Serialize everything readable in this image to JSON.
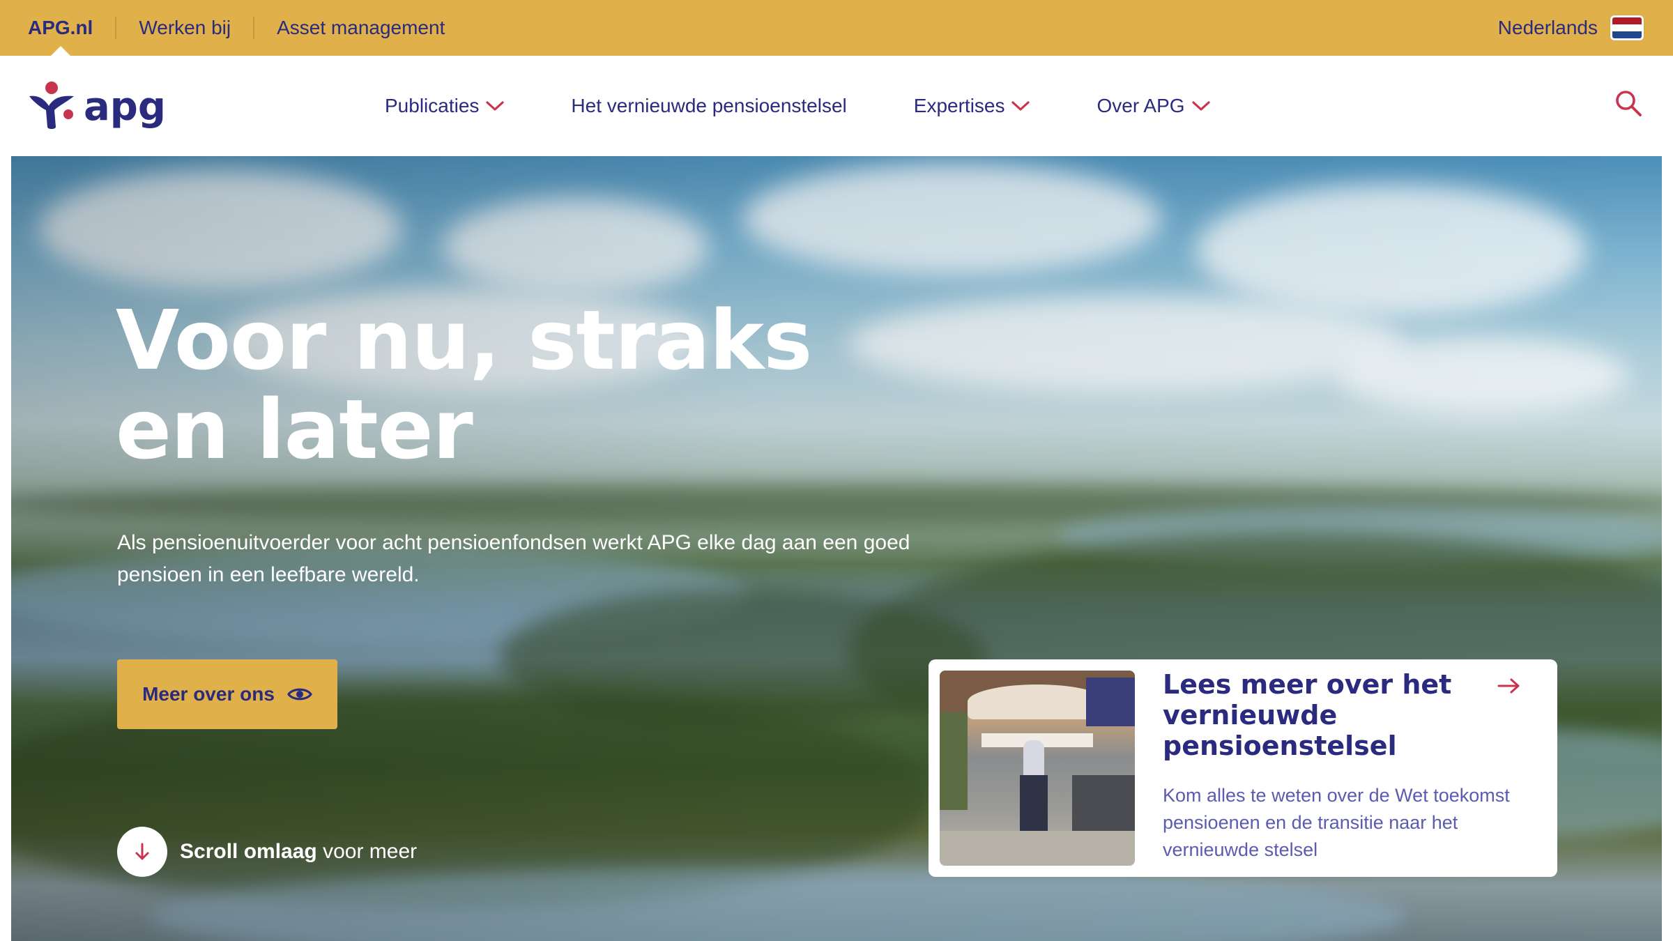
{
  "topbar": {
    "links": [
      {
        "label": "APG.nl",
        "active": true
      },
      {
        "label": "Werken bij",
        "active": false
      },
      {
        "label": "Asset management",
        "active": false
      }
    ],
    "language": "Nederlands",
    "flag_icon": "dutch-flag-icon",
    "background": "#e0b04a"
  },
  "nav": {
    "logo_text": "apg",
    "items": [
      {
        "label": "Publicaties",
        "has_dropdown": true
      },
      {
        "label": "Het vernieuwde pensioenstelsel",
        "has_dropdown": false
      },
      {
        "label": "Expertises",
        "has_dropdown": true
      },
      {
        "label": "Over APG",
        "has_dropdown": true
      }
    ],
    "search_icon": "search-icon"
  },
  "hero": {
    "title": "Voor nu, straks en later",
    "subtitle": "Als pensioenuitvoerder voor acht pensioenfondsen werkt APG elke dag aan een goed pensioen in een leefbare wereld.",
    "cta_label": "Meer over ons",
    "cta_icon": "eye-icon",
    "scroll_bold": "Scroll omlaag",
    "scroll_rest": " voor meer",
    "scroll_icon": "arrow-down-icon"
  },
  "card": {
    "title": "Lees meer over het vernieuwde pensioenstelsel",
    "description": "Kom alles te weten over de Wet toekomst pensioenen en de transitie naar het vernieuwde stelsel",
    "arrow_icon": "arrow-right-icon"
  },
  "colors": {
    "navy": "#2a2a7e",
    "accent_red": "#c8334d",
    "yellow": "#e0b04a",
    "card_text": "#5b5bb0"
  }
}
